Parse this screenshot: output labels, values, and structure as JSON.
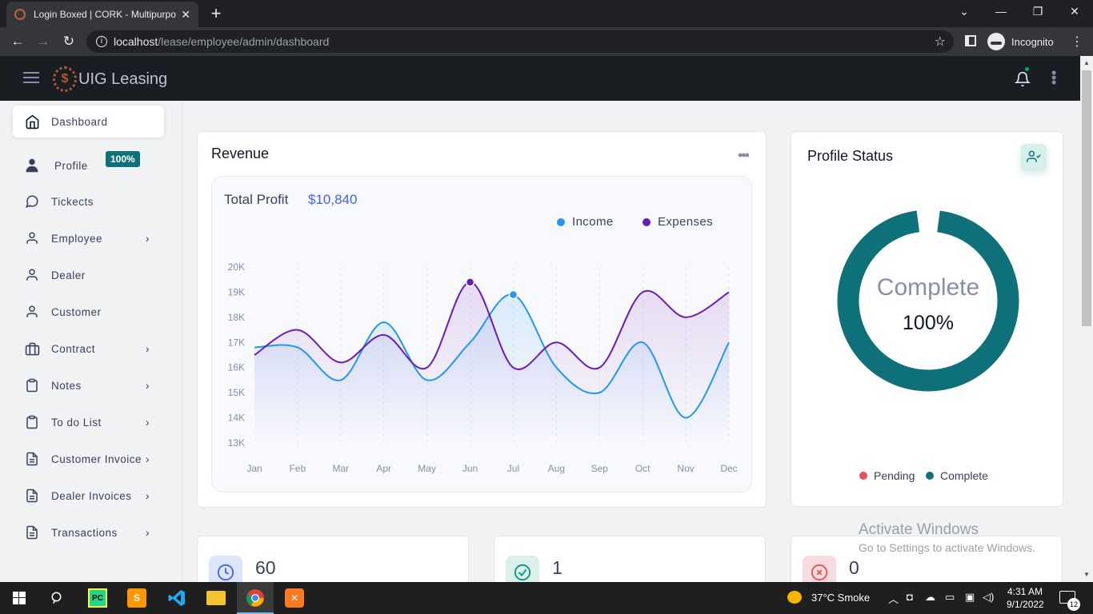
{
  "browser": {
    "tab_title": "Login Boxed | CORK - Multipurpo",
    "url_host": "localhost",
    "url_path": "/lease/employee/admin/dashboard",
    "incognito_label": "Incognito"
  },
  "app": {
    "logo_text": "UIG Leasing",
    "logo_mark": "$"
  },
  "sidebar": {
    "items": [
      {
        "label": "Dashboard",
        "icon": "home-icon"
      },
      {
        "label": "Profile",
        "icon": "user-tie-icon"
      },
      {
        "label": "Tickects",
        "icon": "message-circle-icon"
      },
      {
        "label": "Employee",
        "icon": "user-icon"
      },
      {
        "label": "Dealer",
        "icon": "user-icon"
      },
      {
        "label": "Customer",
        "icon": "user-icon"
      },
      {
        "label": "Contract",
        "icon": "briefcase-icon"
      },
      {
        "label": "Notes",
        "icon": "clipboard-icon"
      },
      {
        "label": "To do List",
        "icon": "clipboard-icon"
      },
      {
        "label": "Customer Invoices",
        "icon": "file-text-icon"
      },
      {
        "label": "Dealer Invoices",
        "icon": "file-text-icon"
      },
      {
        "label": "Transactions",
        "icon": "file-text-icon"
      }
    ],
    "profile_badge": "100%"
  },
  "revenue": {
    "title": "Revenue",
    "total_profit_label": "Total Profit",
    "total_profit_value": "$10,840"
  },
  "chart_data": {
    "type": "area",
    "categories": [
      "Jan",
      "Feb",
      "Mar",
      "Apr",
      "May",
      "Jun",
      "Jul",
      "Aug",
      "Sep",
      "Oct",
      "Nov",
      "Dec"
    ],
    "series": [
      {
        "name": "Income",
        "color": "#2196f3",
        "values": [
          16800,
          16800,
          15500,
          17800,
          15500,
          17000,
          18900,
          16000,
          15000,
          17000,
          14000,
          17000
        ]
      },
      {
        "name": "Expenses",
        "color": "#6a1bb9",
        "values": [
          16500,
          17500,
          16200,
          17300,
          16000,
          19400,
          16000,
          17000,
          16000,
          19000,
          18000,
          19000
        ]
      }
    ],
    "y_ticks": [
      "13K",
      "14K",
      "15K",
      "16K",
      "17K",
      "18K",
      "19K",
      "20K"
    ],
    "ylim": [
      13000,
      20000
    ],
    "legend": "top-right"
  },
  "profile_status": {
    "title": "Profile Status",
    "center_label": "Complete",
    "center_value": "100%",
    "complete_fraction": 1.0,
    "legend": [
      {
        "label": "Pending",
        "color": "#e7515a"
      },
      {
        "label": "Complete",
        "color": "#0e7179"
      }
    ]
  },
  "stats": [
    {
      "value": "60",
      "icon": "clock-icon",
      "color": "#4361ee",
      "bg": "#dde5fb"
    },
    {
      "value": "1",
      "icon": "check-circle-icon",
      "color": "#009688",
      "bg": "#dcefe9"
    },
    {
      "value": "0",
      "icon": "x-circle-icon",
      "color": "#e7515a",
      "bg": "#f6dcdf"
    }
  ],
  "watermark": {
    "title": "Activate Windows",
    "subtitle": "Go to Settings to activate Windows."
  },
  "taskbar": {
    "weather": "37°C  Smoke",
    "time": "4:31 AM",
    "date": "9/1/2022",
    "notifications": "12"
  }
}
